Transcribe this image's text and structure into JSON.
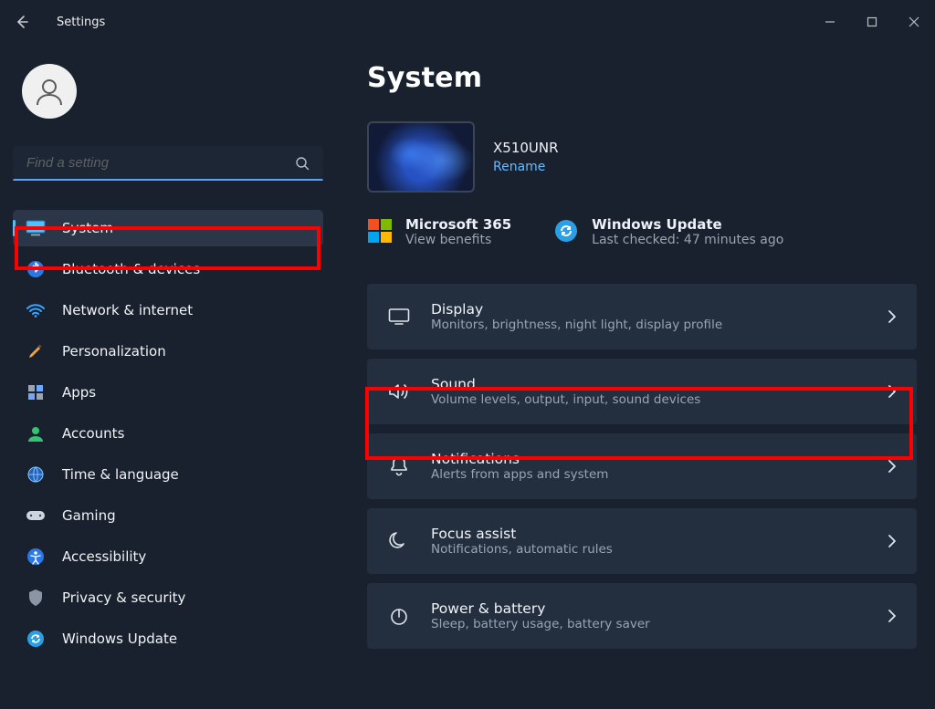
{
  "title": "Settings",
  "search": {
    "placeholder": "Find a setting"
  },
  "nav": {
    "items": [
      "System",
      "Bluetooth & devices",
      "Network & internet",
      "Personalization",
      "Apps",
      "Accounts",
      "Time & language",
      "Gaming",
      "Accessibility",
      "Privacy & security",
      "Windows Update"
    ]
  },
  "main": {
    "heading": "System",
    "device": {
      "model": "X510UNR",
      "rename": "Rename"
    },
    "status": {
      "m365": {
        "title": "Microsoft 365",
        "sub": "View benefits"
      },
      "wu": {
        "title": "Windows Update",
        "sub": "Last checked: 47 minutes ago"
      }
    },
    "cards": [
      {
        "title": "Display",
        "sub": "Monitors, brightness, night light, display profile"
      },
      {
        "title": "Sound",
        "sub": "Volume levels, output, input, sound devices"
      },
      {
        "title": "Notifications",
        "sub": "Alerts from apps and system"
      },
      {
        "title": "Focus assist",
        "sub": "Notifications, automatic rules"
      },
      {
        "title": "Power & battery",
        "sub": "Sleep, battery usage, battery saver"
      }
    ]
  }
}
